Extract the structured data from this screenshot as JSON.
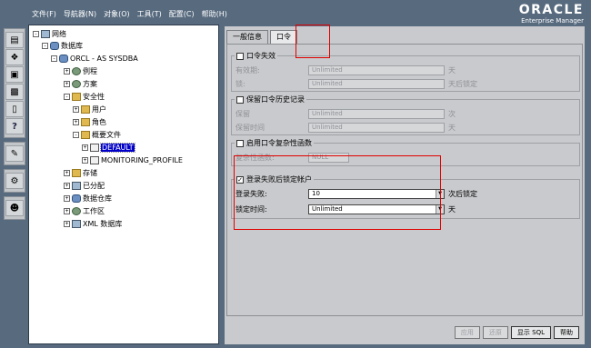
{
  "menu": [
    "文件(F)",
    "导航器(N)",
    "对象(O)",
    "工具(T)",
    "配置(C)",
    "帮助(H)"
  ],
  "brand": {
    "line1": "ORACLE",
    "line2": "Enterprise Manager"
  },
  "toolbar": {
    "group1": [
      "folder-icon",
      "puzzle-icon",
      "cube-icon",
      "network-icon",
      "trash-icon",
      "help-icon"
    ],
    "group2": [
      "sql-worksheet-icon"
    ],
    "group3": [
      "tools-icon"
    ],
    "group4": [
      "users-icon"
    ]
  },
  "tree": {
    "network": "网络",
    "databases": "数据库",
    "db": "ORCL - AS SYSDBA",
    "instance": "例程",
    "schema": "方案",
    "security": "安全性",
    "users": "用户",
    "roles": "角色",
    "profiles": "概要文件",
    "profile_default": "DEFAULT",
    "profile_monitoring": "MONITORING_PROFILE",
    "storage": "存储",
    "distributed": "已分配",
    "warehouse": "数据仓库",
    "workspace": "工作区",
    "xmldb": "XML 数据库"
  },
  "tabs": [
    "一般信息",
    "口令"
  ],
  "expire": {
    "title": "口令失效",
    "validity_label": "有效期:",
    "validity_value": "Unlimited",
    "validity_unit": "天",
    "lock_label": "锁:",
    "lock_value": "Unlimited",
    "lock_unit": "天后锁定"
  },
  "history": {
    "title": "保留口令历史记录",
    "keep_label": "保留",
    "keep_value": "Unlimited",
    "keep_unit": "次",
    "time_label": "保留时间",
    "time_value": "Unlimited",
    "time_unit": "天"
  },
  "complexity": {
    "title": "启用口令复杂性函数",
    "func_label": "复杂性函数:",
    "func_value": "NULL"
  },
  "lock": {
    "title": "登录失败后锁定帐户",
    "checked": "✓",
    "fail_label": "登录失败:",
    "fail_value": "10",
    "fail_unit": "次后锁定",
    "time_label": "锁定时间:",
    "time_value": "Unlimited",
    "time_unit": "天"
  },
  "buttons": {
    "apply": "应用",
    "revert": "还原",
    "show_sql": "显示 SQL",
    "help": "帮助"
  }
}
